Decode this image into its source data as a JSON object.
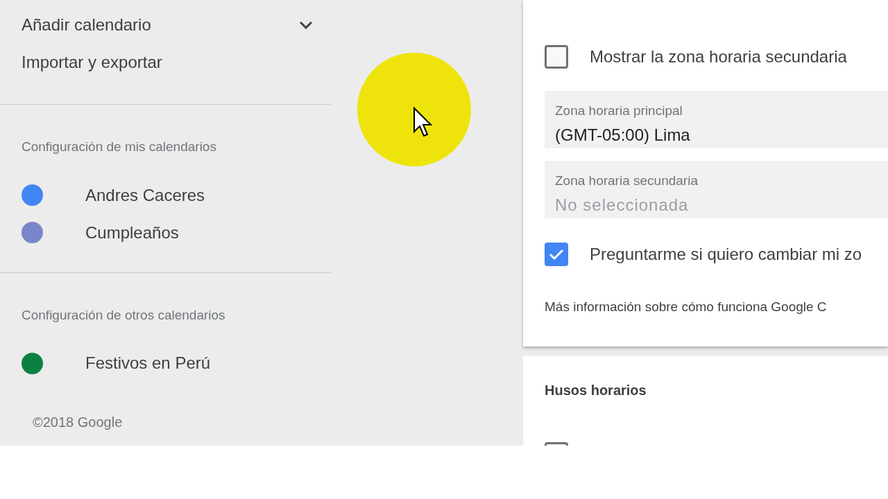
{
  "sidebar": {
    "top_items": [
      {
        "label": "Añadir calendario",
        "expandable": true
      },
      {
        "label": "Importar y exportar",
        "expandable": false
      }
    ],
    "sections": [
      {
        "heading": "Configuración de mis calendarios",
        "calendars": [
          {
            "name": "Andres Caceres",
            "color": "#4285f4"
          },
          {
            "name": "Cumpleaños",
            "color": "#7986cb"
          }
        ]
      },
      {
        "heading": "Configuración de otros calendarios",
        "calendars": [
          {
            "name": "Festivos en Perú",
            "color": "#0b8043"
          }
        ]
      }
    ],
    "footer": "©2018 Google"
  },
  "timezone_card": {
    "show_secondary": {
      "label": "Mostrar la zona horaria secundaria",
      "checked": false
    },
    "fields": [
      {
        "label": "Zona horaria principal",
        "value": "(GMT-05:00) Lima"
      },
      {
        "label": "Zona horaria secundaria",
        "placeholder": "No seleccionada"
      }
    ],
    "ask_change": {
      "label": "Preguntarme si quiero cambiar mi zo",
      "checked": true
    },
    "info": "Más información sobre cómo funciona Google C"
  },
  "world_clock_card": {
    "title": "Husos horarios",
    "checkbox": {
      "checked": false
    }
  }
}
